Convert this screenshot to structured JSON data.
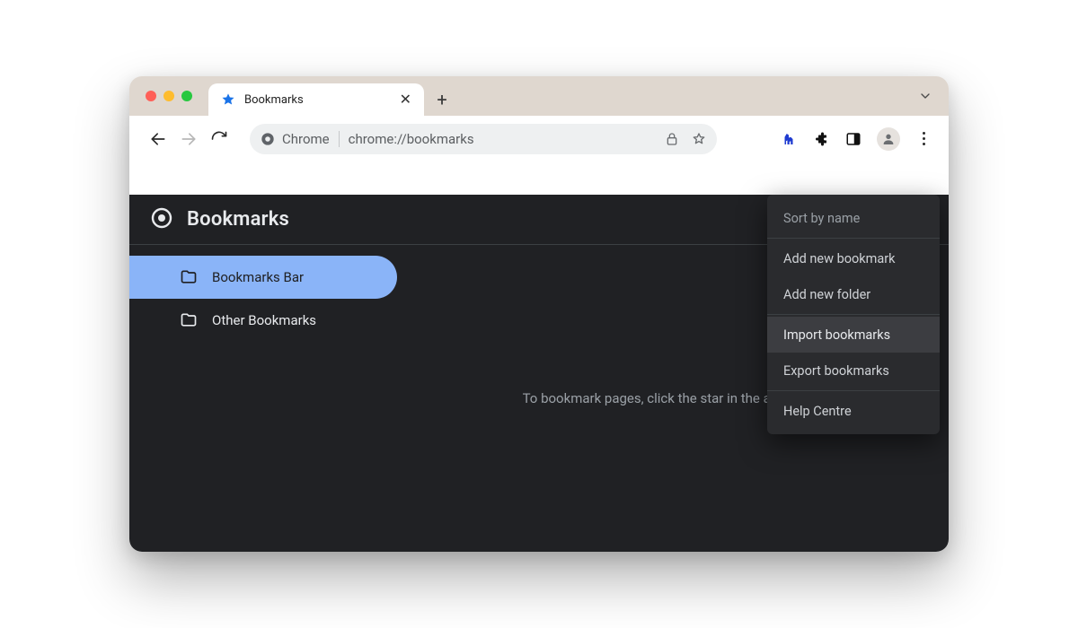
{
  "tab": {
    "title": "Bookmarks"
  },
  "omnibox": {
    "chip": "Chrome",
    "url": "chrome://bookmarks"
  },
  "bookmarks": {
    "title": "Bookmarks",
    "sidebar": {
      "items": [
        {
          "label": "Bookmarks Bar",
          "active": true
        },
        {
          "label": "Other Bookmarks",
          "active": false
        }
      ]
    },
    "hint": "To bookmark pages, click the star in the address bar"
  },
  "menu": {
    "items": [
      {
        "label": "Sort by name",
        "muted": true
      },
      {
        "label": "Add new bookmark"
      },
      {
        "label": "Add new folder"
      },
      {
        "label": "Import bookmarks",
        "hover": true
      },
      {
        "label": "Export bookmarks"
      },
      {
        "label": "Help Centre"
      }
    ]
  }
}
